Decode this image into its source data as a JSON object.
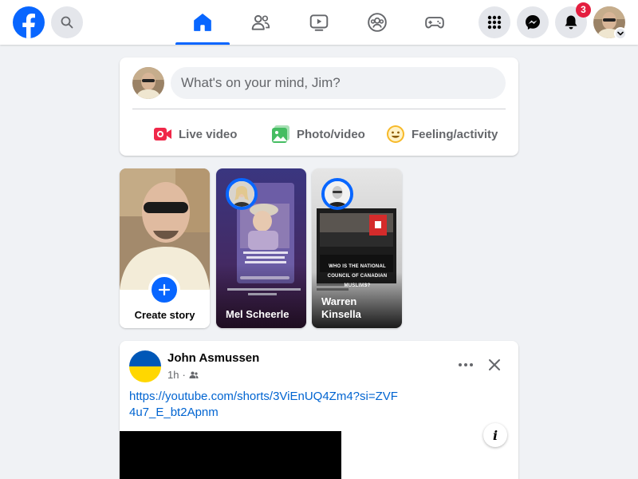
{
  "header": {
    "logo": "facebook-logo",
    "search_icon": "search-icon",
    "nav": [
      {
        "name": "home",
        "icon": "home-icon",
        "active": true
      },
      {
        "name": "friends",
        "icon": "friends-icon",
        "active": false
      },
      {
        "name": "video",
        "icon": "video-icon",
        "active": false
      },
      {
        "name": "groups",
        "icon": "groups-icon",
        "active": false
      },
      {
        "name": "gaming",
        "icon": "gaming-icon",
        "active": false
      }
    ],
    "notifications_count": "3"
  },
  "composer": {
    "placeholder": "What's on your mind, Jim?",
    "actions": [
      {
        "label": "Live video",
        "icon": "live-video-icon",
        "color": "#f02849"
      },
      {
        "label": "Photo/video",
        "icon": "photo-icon",
        "color": "#45bd62"
      },
      {
        "label": "Feeling/activity",
        "icon": "feeling-icon",
        "color": "#f7b928"
      }
    ]
  },
  "stories": {
    "create_label": "Create story",
    "items": [
      {
        "name": "Mel Scheerle",
        "caption": "Happy Stampede Weekend to all who celebrate"
      },
      {
        "name": "Warren Kinsella",
        "headline": "WHO IS THE NATIONAL COUNCIL OF CANADIAN MUSLIMS?"
      }
    ]
  },
  "post": {
    "author": "John Asmussen",
    "time": "1h",
    "audience_icon": "friends-audience-icon",
    "link": "https://youtube.com/shorts/3ViEnUQ4Zm4?si=ZVF4u7_E_bt2Apnm",
    "info_label": "i"
  },
  "colors": {
    "brand": "#0866ff",
    "background": "#f0f2f5",
    "badge": "#e41e3f",
    "link": "#0064d1"
  }
}
